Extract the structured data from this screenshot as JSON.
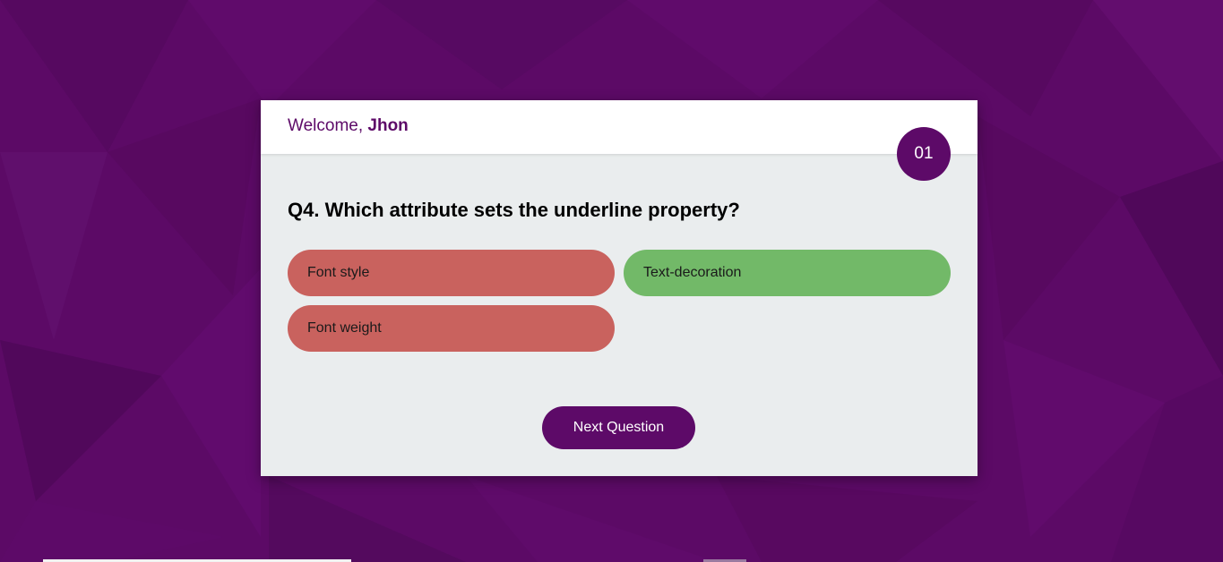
{
  "header": {
    "welcome_prefix": "Welcome,",
    "user_name": "Jhon"
  },
  "question_counter": "01",
  "question": {
    "text": "Q4. Which attribute sets the underline property?"
  },
  "options": [
    {
      "label": "Font style",
      "state": "wrong"
    },
    {
      "label": "Text-decoration",
      "state": "correct"
    },
    {
      "label": "Font weight",
      "state": "wrong"
    }
  ],
  "next_button": {
    "label": "Next Question"
  },
  "colors": {
    "brand": "#5d0a68",
    "wrong": "#c9625e",
    "correct": "#72b968",
    "card_body": "#eaedee",
    "background": "#5c0a66"
  }
}
